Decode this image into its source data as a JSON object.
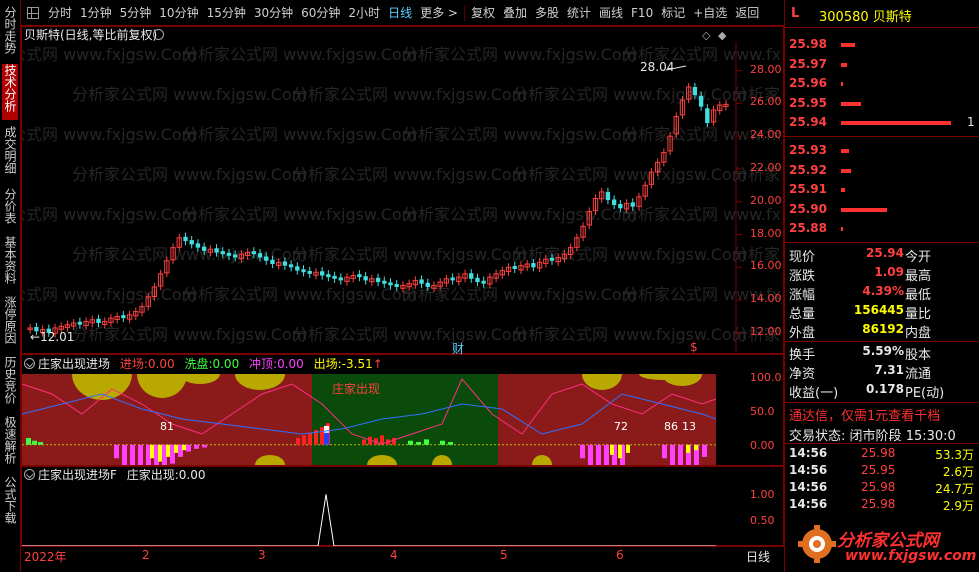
{
  "toolbar": {
    "items": [
      "分时",
      "1分钟",
      "5分钟",
      "10分钟",
      "15分钟",
      "30分钟",
      "60分钟",
      "2小时",
      "日线",
      "更多 >",
      "复权",
      "叠加",
      "多股",
      "统计",
      "画线",
      "F10",
      "标记",
      "+自选",
      "返回"
    ],
    "active_index": 8
  },
  "left_tabs": [
    {
      "label": "分时走势",
      "active": false
    },
    {
      "label": "技术分析",
      "active": true
    },
    {
      "label": "成交明细",
      "active": false
    },
    {
      "label": "分价表",
      "active": false
    },
    {
      "label": "基本资料",
      "active": false
    },
    {
      "label": "涨停原因",
      "active": false
    },
    {
      "label": "历史竞价",
      "active": false
    },
    {
      "label": "极速解析",
      "active": false
    },
    {
      "label": "公式下载",
      "active": false
    }
  ],
  "main_chart": {
    "title": "贝斯特(日线,等比前复权)",
    "high_label": "28.04",
    "low_label": "12.01",
    "marker_cai": "财",
    "marker_s": "$",
    "y_ticks": [
      "28.00",
      "26.00",
      "24.00",
      "22.00",
      "20.00",
      "18.00",
      "16.00",
      "14.00",
      "12.00"
    ],
    "y_tick_values": [
      28,
      26,
      24,
      22,
      20,
      18,
      16,
      14,
      12
    ],
    "price_range": [
      11.2,
      29.5
    ],
    "candles": [
      12.3,
      12.1,
      12.2,
      12.0,
      12.3,
      12.4,
      12.5,
      12.6,
      12.5,
      12.7,
      12.8,
      12.6,
      12.7,
      12.9,
      13.0,
      12.9,
      13.1,
      13.3,
      13.6,
      14.2,
      14.8,
      15.6,
      16.4,
      17.2,
      17.8,
      17.6,
      17.4,
      17.2,
      17.0,
      17.1,
      16.9,
      16.8,
      16.7,
      16.6,
      16.8,
      16.9,
      16.8,
      16.6,
      16.4,
      16.2,
      16.3,
      16.1,
      16.0,
      15.8,
      15.7,
      15.6,
      15.7,
      15.5,
      15.4,
      15.3,
      15.2,
      15.4,
      15.5,
      15.4,
      15.2,
      15.3,
      15.1,
      15.0,
      14.9,
      14.8,
      14.9,
      15.0,
      15.2,
      15.0,
      14.8,
      14.9,
      15.1,
      15.3,
      15.2,
      15.4,
      15.6,
      15.3,
      15.1,
      15.0,
      15.4,
      15.6,
      15.8,
      16.0,
      15.9,
      16.1,
      16.2,
      16.0,
      16.3,
      16.5,
      16.4,
      16.6,
      16.8,
      17.2,
      17.8,
      18.5,
      19.4,
      20.2,
      20.6,
      20.1,
      19.8,
      19.6,
      19.9,
      19.7,
      20.3,
      21.0,
      21.8,
      22.4,
      23.0,
      24.0,
      25.2,
      26.2,
      27.0,
      26.5,
      25.8,
      24.8,
      25.6,
      25.9,
      25.94
    ]
  },
  "indicator1": {
    "title": "庄家出现进场",
    "jinchang_label": "进场:",
    "jinchang_value": "0.00",
    "xipan_label": "洗盘:",
    "xipan_value": "0.00",
    "chongding_label": "冲顶:",
    "chongding_value": "0.00",
    "chuchang_label": "出场:",
    "chuchang_value": "-3.51",
    "arrow": "↑",
    "zhuangjia_label": "庄家出现",
    "y_ticks": [
      "100.0",
      "50.0",
      "0.00"
    ],
    "y_tick_values": [
      100,
      50,
      0
    ],
    "range": [
      -30,
      105
    ],
    "labels_81": "81",
    "label_72": "72",
    "label_86": "86",
    "label_13": "13"
  },
  "indicator2": {
    "title": "庄家出现进场F",
    "sub_label": "庄家出现:",
    "sub_value": "0.00",
    "y_ticks": [
      "1.00",
      "0.50"
    ],
    "y_tick_values": [
      1,
      0.5
    ],
    "range": [
      0,
      1.2
    ]
  },
  "xaxis": {
    "labels": [
      "2022年",
      "2",
      "3",
      "4",
      "5",
      "6"
    ],
    "period_label": "日线"
  },
  "watermark": "分析家公式网 www.fxjgsw.Com",
  "right_panel": {
    "header_l": "L",
    "code_name": "300580 贝斯特",
    "asks": [
      {
        "price": "25.98",
        "width": 14
      },
      {
        "price": "25.97",
        "width": 6
      },
      {
        "price": "25.96",
        "width": 2
      },
      {
        "price": "25.95",
        "width": 20
      },
      {
        "price": "25.94",
        "width": 110,
        "qty": "1"
      }
    ],
    "bids": [
      {
        "price": "25.93",
        "width": 8
      },
      {
        "price": "25.92",
        "width": 10
      },
      {
        "price": "25.91",
        "width": 4
      },
      {
        "price": "25.90",
        "width": 46
      },
      {
        "price": "25.88",
        "width": 2
      }
    ],
    "quote": [
      {
        "l": "现价",
        "v": "25.94",
        "r": "今开"
      },
      {
        "l": "涨跌",
        "v": "1.09",
        "r": "最高"
      },
      {
        "l": "涨幅",
        "v": "4.39%",
        "r": "最低"
      },
      {
        "l": "总量",
        "v": "156445",
        "r": "量比"
      },
      {
        "l": "外盘",
        "v": "86192",
        "r": "内盘"
      }
    ],
    "quote2": [
      {
        "l": "换手",
        "v": "5.59%",
        "r": "股本"
      },
      {
        "l": "净资",
        "v": "7.31",
        "r": "流通"
      },
      {
        "l": "收益(一)",
        "v": "0.178",
        "r": "PE(动)"
      }
    ],
    "ad": "通达信，仅需1元查看千档",
    "status_label": "交易状态:",
    "status_value": "闭市阶段",
    "status_time": "15:30:0",
    "ticks": [
      {
        "t": "14:56",
        "p": "25.98",
        "v": "53.3万"
      },
      {
        "t": "14:56",
        "p": "25.95",
        "v": "2.6万"
      },
      {
        "t": "14:56",
        "p": "25.98",
        "v": "24.7万"
      },
      {
        "t": "14:56",
        "p": "25.98",
        "v": "2.9万"
      }
    ],
    "logo_text": "分析家公式网",
    "logo_url": "www.fxjgsw.com"
  },
  "colors": {
    "up": "#ff4040",
    "down": "#40e0e0",
    "accent": "#5ad2ff",
    "bg": "#000000",
    "border": "#7a0000"
  }
}
